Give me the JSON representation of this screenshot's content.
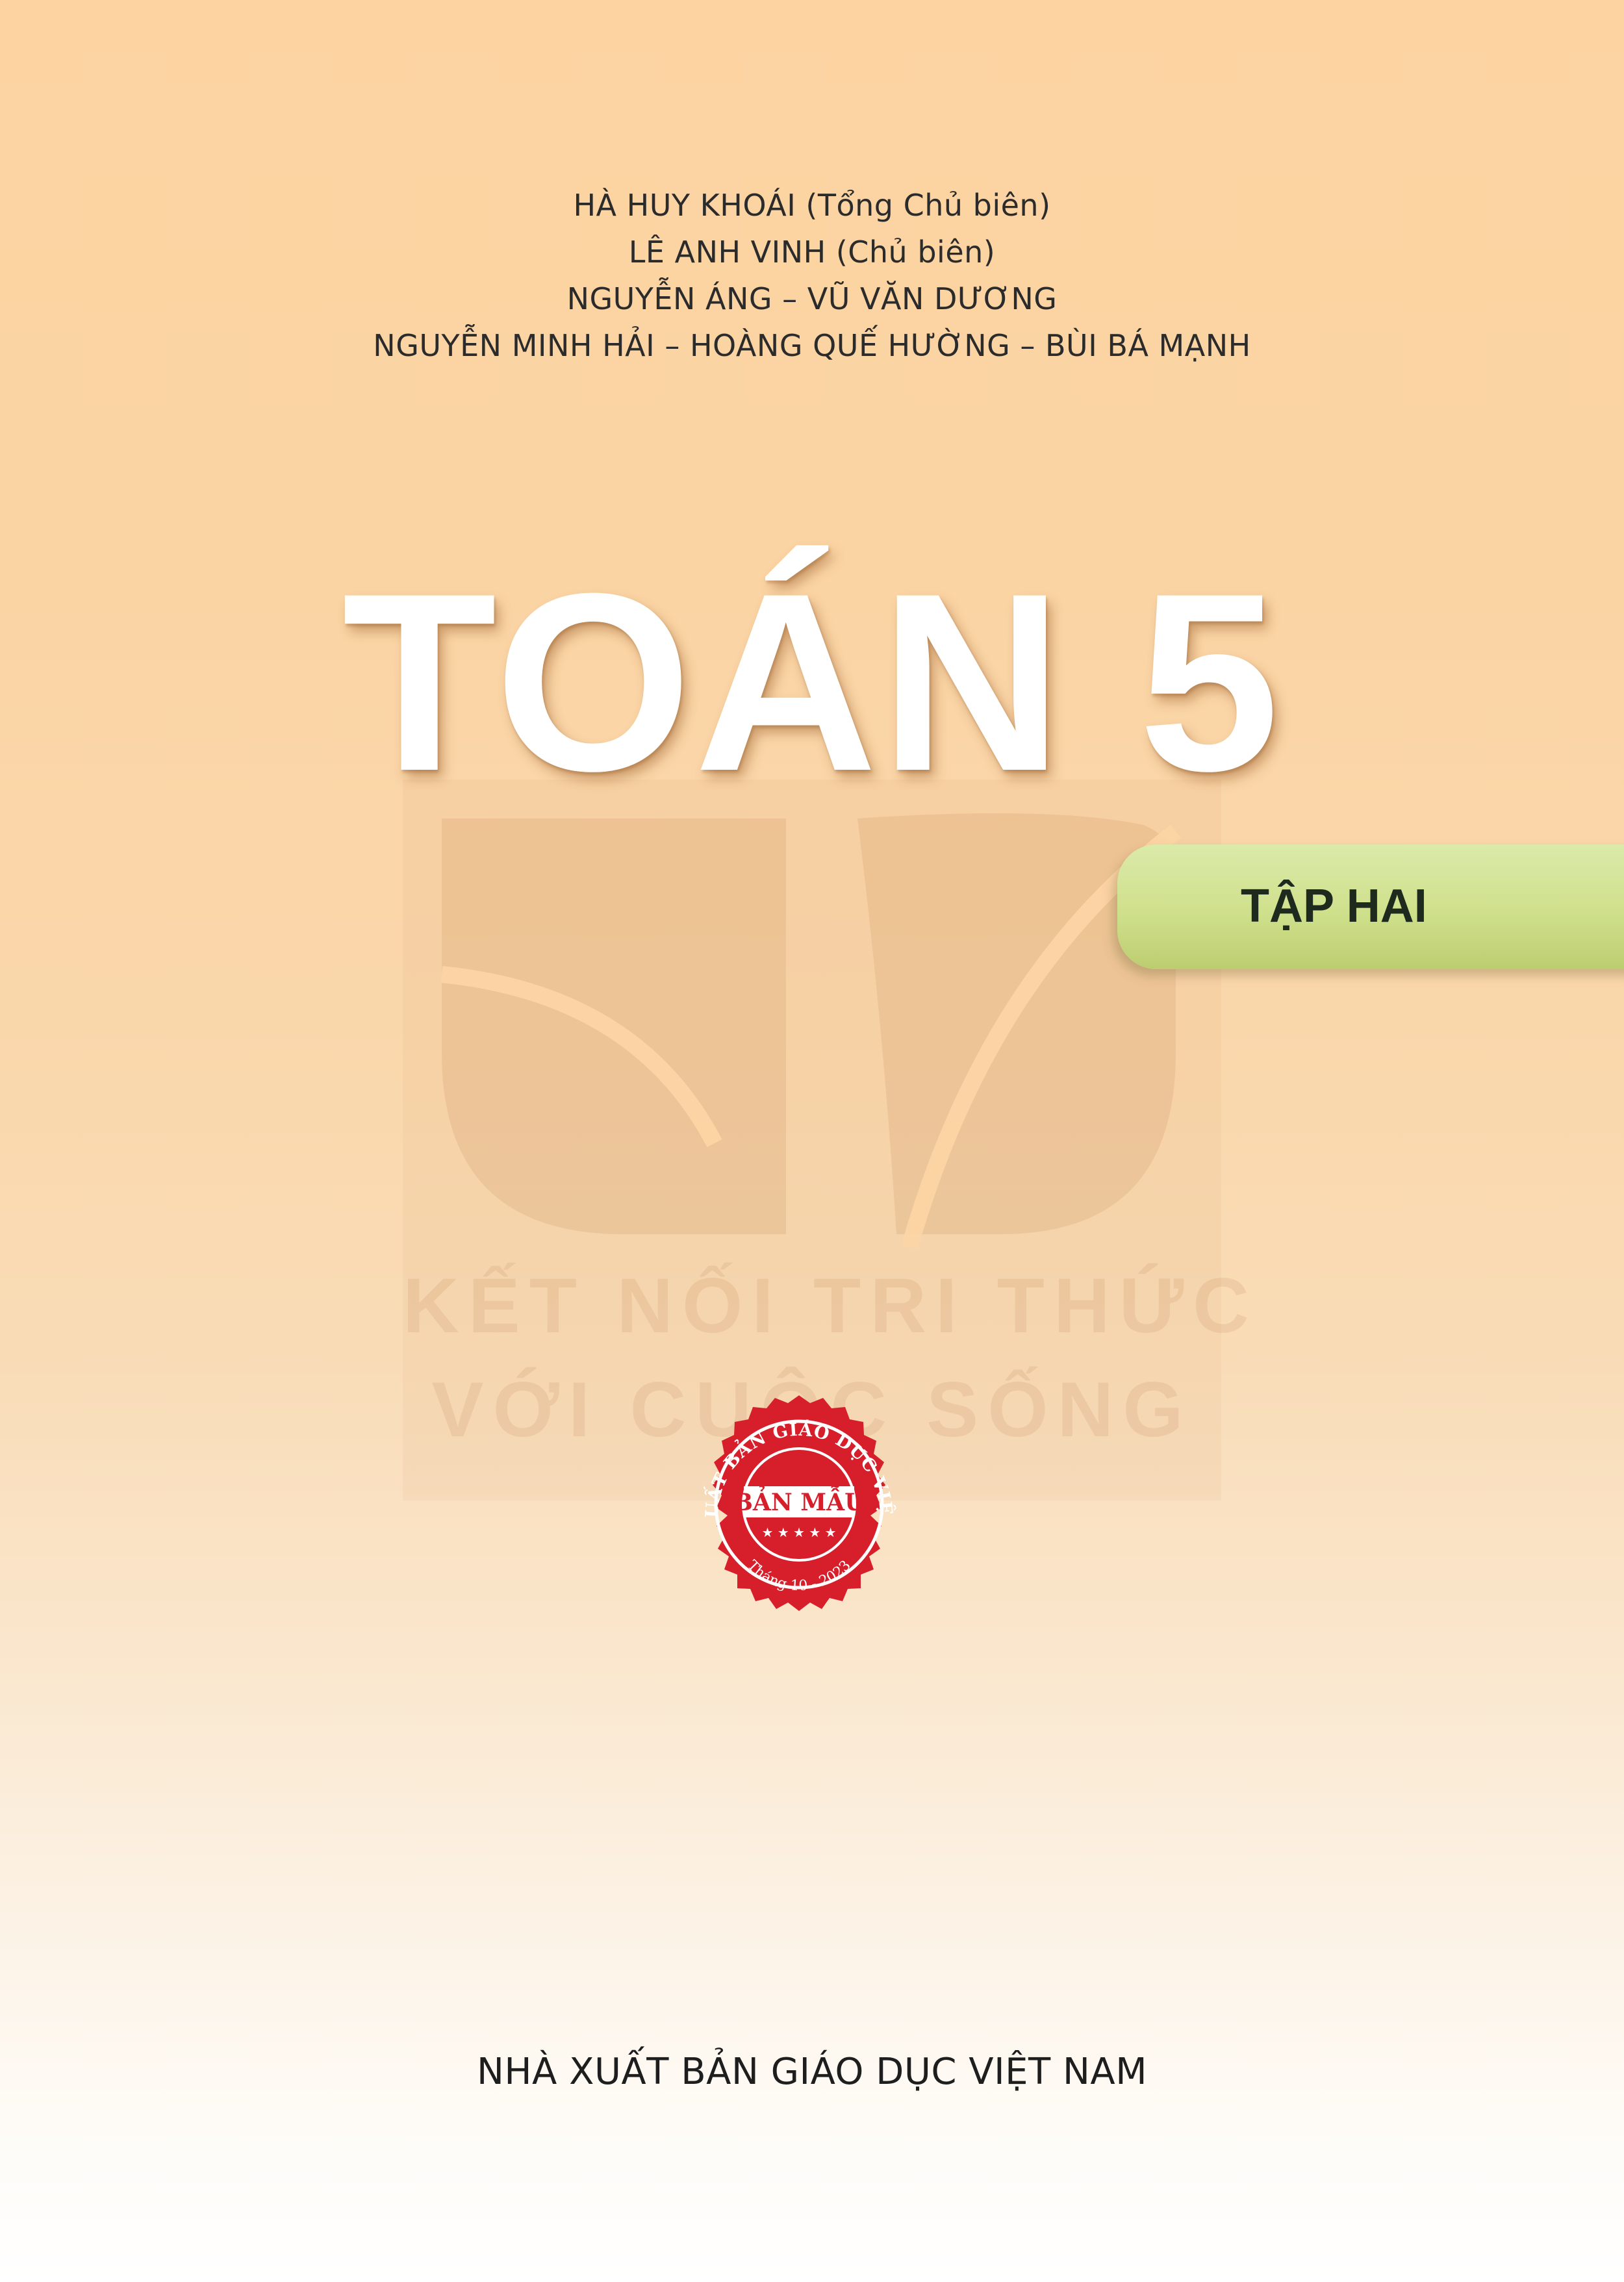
{
  "authors": [
    "HÀ HUY KHOÁI (Tổng Chủ biên)",
    "LÊ ANH VINH (Chủ biên)",
    "NGUYỄN ÁNG – VŨ VĂN DƯƠNG",
    "NGUYỄN MINH HẢI – HOÀNG QUẾ HƯỜNG – BÙI BÁ MẠNH"
  ],
  "title": "TOÁN 5",
  "volume": "TẬP HAI",
  "watermark": {
    "line1": "KẾT NỐI TRI THỨC",
    "line2": "VỚI CUỘC SỐNG"
  },
  "seal": {
    "ring_text": "NHÀ XUẤT BẢN GIÁO DỤC VIỆT NAM",
    "center_text": "BẢN MẪU",
    "date_text": "Tháng 10 - 2023",
    "color": "#d71f2b"
  },
  "publisher": "NHÀ XUẤT BẢN GIÁO DỤC VIỆT NAM",
  "colors": {
    "background_top": "#fcd3a1",
    "background_bottom": "#ffffff",
    "tab_green": "#cfe08c"
  }
}
